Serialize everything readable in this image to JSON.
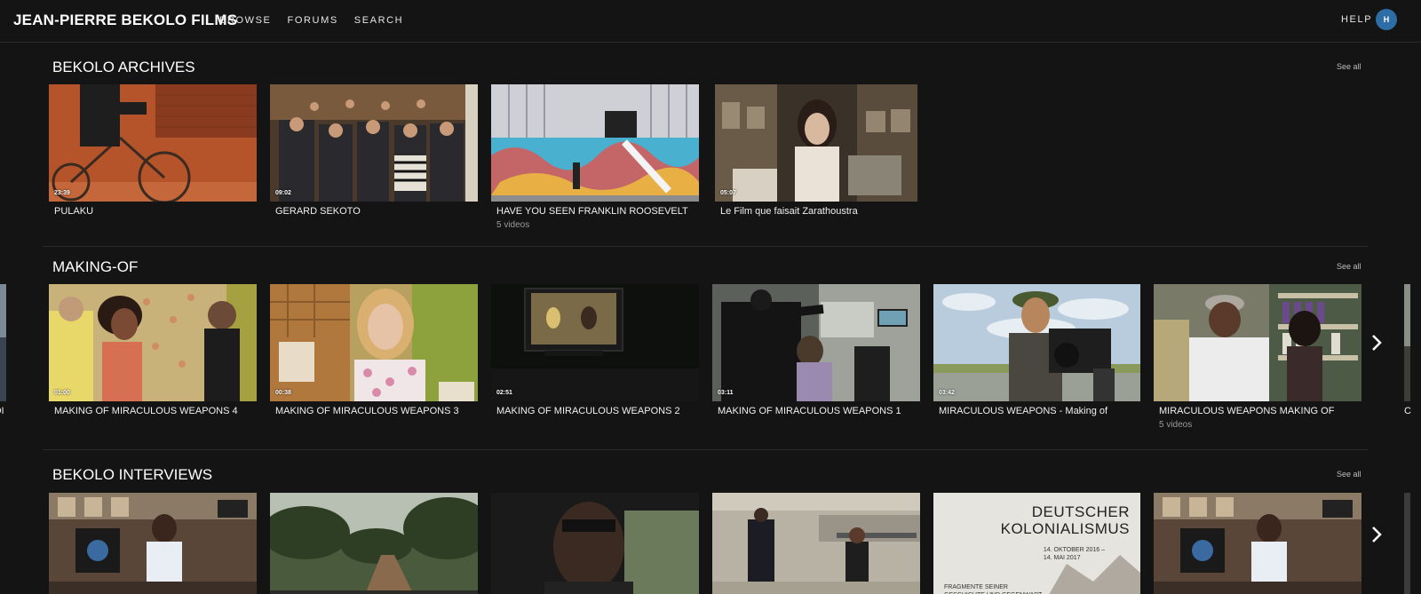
{
  "header": {
    "brand": "JEAN-PIERRE BEKOLO FILMS",
    "nav": [
      "BROWSE",
      "FORUMS",
      "SEARCH"
    ],
    "help": "HELP",
    "avatar_initial": "H",
    "avatar_color": "#2d6ea7"
  },
  "sections": [
    {
      "title": "BEKOLO ARCHIVES",
      "see_all": "See all",
      "items": [
        {
          "title": "PULAKU",
          "duration": "23:39",
          "subtitle": ""
        },
        {
          "title": "GERARD SEKOTO",
          "duration": "09:02",
          "subtitle": ""
        },
        {
          "title": "HAVE YOU SEEN FRANKLIN ROOSEVELT",
          "duration": "",
          "subtitle": "5 videos"
        },
        {
          "title": "Le Film que faisait Zarathoustra",
          "duration": "05:07",
          "subtitle": ""
        }
      ]
    },
    {
      "title": "MAKING-OF",
      "see_all": "See all",
      "left_partial_label": "OI",
      "right_partial_label": "C",
      "items": [
        {
          "title": "MAKING OF MIRACULOUS WEAPONS 4",
          "duration": "01:00",
          "subtitle": ""
        },
        {
          "title": "MAKING OF MIRACULOUS WEAPONS 3",
          "duration": "00:38",
          "subtitle": ""
        },
        {
          "title": "MAKING OF MIRACULOUS WEAPONS 2",
          "duration": "02:51",
          "subtitle": ""
        },
        {
          "title": "MAKING OF MIRACULOUS WEAPONS 1",
          "duration": "03:11",
          "subtitle": ""
        },
        {
          "title": "MIRACULOUS WEAPONS - Making of",
          "duration": "03:42",
          "subtitle": ""
        },
        {
          "title": "MIRACULOUS WEAPONS MAKING OF",
          "duration": "",
          "subtitle": "5 videos"
        }
      ]
    },
    {
      "title": "BEKOLO INTERVIEWS",
      "see_all": "See all",
      "items": [
        {
          "title": "",
          "duration": "",
          "subtitle": ""
        },
        {
          "title": "",
          "duration": "",
          "subtitle": ""
        },
        {
          "title": "",
          "duration": "",
          "subtitle": ""
        },
        {
          "title": "",
          "duration": "",
          "subtitle": ""
        },
        {
          "title": "",
          "duration": "",
          "subtitle": "",
          "poster_title": "DEUTSCHER\nKOLONIALISMUS",
          "poster_date": "14. OKTOBER 2016 –\n14. MAI 2017",
          "poster_caption": "FRAGMENTE SEINER\nGESCHICHTE UND GEGENWART"
        },
        {
          "title": "",
          "duration": "",
          "subtitle": ""
        }
      ]
    }
  ]
}
